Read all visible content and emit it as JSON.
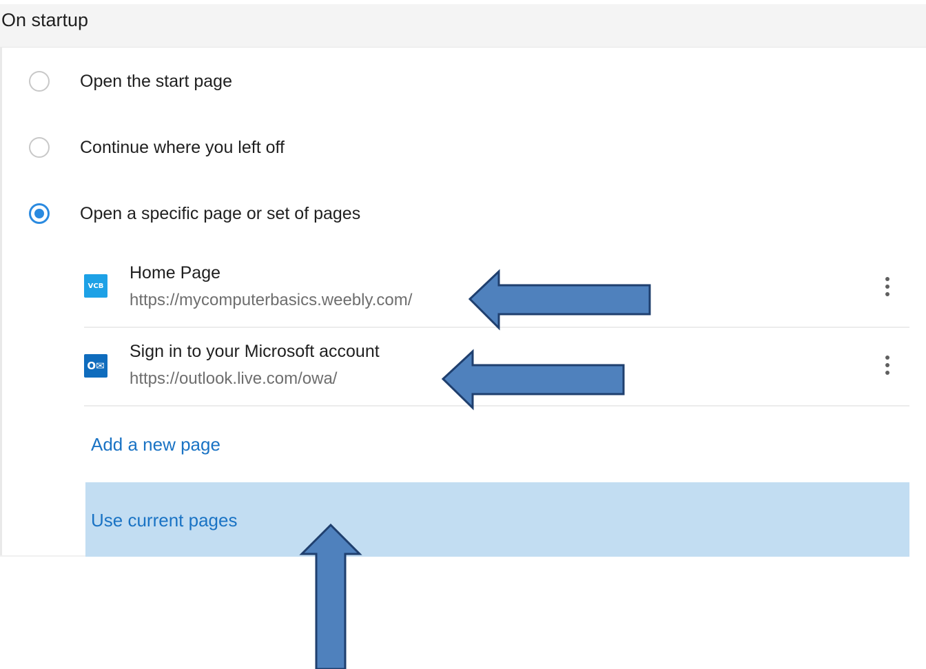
{
  "section": {
    "title": "On startup"
  },
  "startup_options": [
    {
      "label": "Open the start page",
      "selected": false
    },
    {
      "label": "Continue where you left off",
      "selected": false
    },
    {
      "label": "Open a specific page or set of pages",
      "selected": true
    }
  ],
  "pages": [
    {
      "favicon": "VCB",
      "favicon_icon": "vcb-favicon-icon",
      "title": "Home Page",
      "url": "https://mycomputerbasics.weebly.com/"
    },
    {
      "favicon": "O✉",
      "favicon_icon": "outlook-favicon-icon",
      "title": "Sign in to your Microsoft account",
      "url": "https://outlook.live.com/owa/"
    }
  ],
  "actions": {
    "add_new_page": "Add a new page",
    "use_current_pages": "Use current pages"
  },
  "colors": {
    "accent": "#2a8ae0",
    "link": "#1a73c4",
    "highlight": "#c2ddf2",
    "annotation_arrow": "#4f81bd",
    "annotation_arrow_border": "#1f3f6e"
  }
}
